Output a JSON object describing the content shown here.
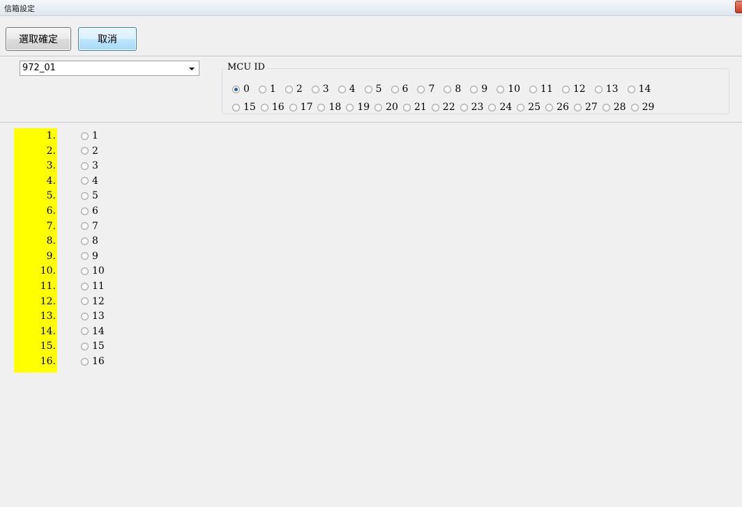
{
  "window": {
    "title": "信箱設定"
  },
  "toolbar": {
    "confirm_label": "選取確定",
    "cancel_label": "取消"
  },
  "combo": {
    "value": "972_01"
  },
  "mcu_group": {
    "title": "MCU ID",
    "selected": "0",
    "options_row1": [
      "0",
      "1",
      "2",
      "3",
      "4",
      "5",
      "6",
      "7",
      "8",
      "9",
      "10",
      "11",
      "12",
      "13",
      "14"
    ],
    "options_row2": [
      "15",
      "16",
      "17",
      "18",
      "19",
      "20",
      "21",
      "22",
      "23",
      "24",
      "25",
      "26",
      "27",
      "28",
      "29"
    ]
  },
  "list": {
    "numbers": [
      "1.",
      "2.",
      "3.",
      "4.",
      "5.",
      "6.",
      "7.",
      "8.",
      "9.",
      "10.",
      "11.",
      "12.",
      "13.",
      "14.",
      "15.",
      "16."
    ],
    "options": [
      "1",
      "2",
      "3",
      "4",
      "5",
      "6",
      "7",
      "8",
      "9",
      "10",
      "11",
      "12",
      "13",
      "14",
      "15",
      "16"
    ]
  },
  "colors": {
    "highlight": "#ffff00",
    "background": "#f0f0f0"
  }
}
